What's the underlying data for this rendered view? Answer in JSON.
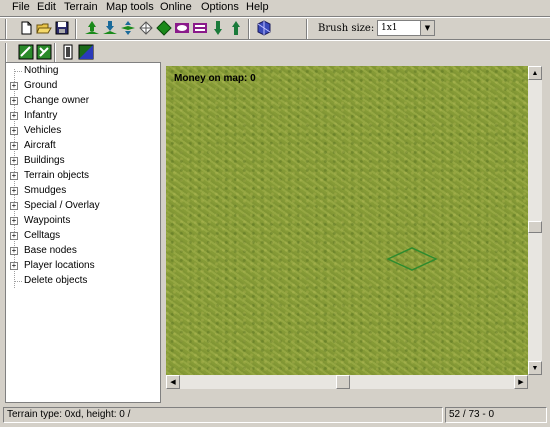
{
  "menu": [
    "File",
    "Edit",
    "Terrain",
    "Map tools",
    "Online",
    "Options",
    "Help"
  ],
  "toolbar": {
    "buttons_row1": [
      "new-file-icon",
      "open-folder-icon",
      "save-icon",
      "raise-terrain-icon",
      "lower-terrain-icon",
      "flatten-terrain-icon",
      "raise-tile-icon",
      "lower-tile-icon",
      "ramp-icon",
      "smooth-icon",
      "cliff-up-icon",
      "cliff-down-icon",
      "auto-terrain-icon"
    ],
    "brush_label": "Brush size:",
    "brush_value": "1x1",
    "buttons_row2": [
      "terrain-texture-icon",
      "terrain-texture-alt-icon",
      "door-icon",
      "map-overview-icon"
    ]
  },
  "tree": {
    "items": [
      {
        "label": "Nothing",
        "expandable": false
      },
      {
        "label": "Ground",
        "expandable": true
      },
      {
        "label": "Change owner",
        "expandable": true
      },
      {
        "label": "Infantry",
        "expandable": true
      },
      {
        "label": "Vehicles",
        "expandable": true
      },
      {
        "label": "Aircraft",
        "expandable": true
      },
      {
        "label": "Buildings",
        "expandable": true
      },
      {
        "label": "Terrain objects",
        "expandable": true
      },
      {
        "label": "Smudges",
        "expandable": true
      },
      {
        "label": "Special / Overlay",
        "expandable": true
      },
      {
        "label": "Waypoints",
        "expandable": true
      },
      {
        "label": "Celltags",
        "expandable": true
      },
      {
        "label": "Base nodes",
        "expandable": true
      },
      {
        "label": "Player locations",
        "expandable": true
      },
      {
        "label": "Delete objects",
        "expandable": false
      }
    ]
  },
  "map": {
    "money_text": "Money on map: 0"
  },
  "status": {
    "terrain_info": "Terrain type: 0xd, height: 0 /",
    "coords": "52 / 73 - 0"
  },
  "colors": {
    "chrome": "#d4d0c8",
    "grass": "#8ea33e",
    "cursor": "#2e8b2e"
  }
}
